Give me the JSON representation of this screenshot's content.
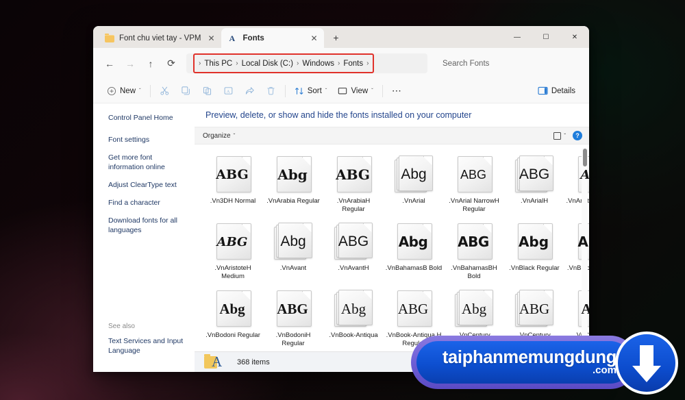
{
  "window": {
    "tabs": [
      {
        "label": "Font chu viet tay - VPM",
        "icon": "folder-icon",
        "active": false
      },
      {
        "label": "Fonts",
        "icon": "font-folder-icon",
        "active": true
      }
    ],
    "new_tab_label": "+",
    "controls": {
      "minimize": "—",
      "maximize": "☐",
      "close": "✕"
    }
  },
  "navigation": {
    "back_label": "←",
    "forward_label": "→",
    "up_label": "↑",
    "refresh_label": "⟳",
    "this_pc_icon": "monitor-icon",
    "breadcrumbs": [
      "This PC",
      "Local Disk (C:)",
      "Windows",
      "Fonts"
    ],
    "separator": "›",
    "leading_separator": "›",
    "trailing_separator": "›",
    "highlight_color": "#e0312a",
    "search_placeholder": "Search Fonts"
  },
  "toolbar": {
    "new_label": "New",
    "chevron": "ˇ",
    "cut_label": "cut-icon",
    "copy_label": "copy-icon",
    "paste_label": "paste-icon",
    "rename_label": "rename-icon",
    "share_label": "share-icon",
    "delete_label": "delete-icon",
    "sort_label": "Sort",
    "view_label": "View",
    "more_label": "⋯",
    "details_label": "Details"
  },
  "sidebar": {
    "home_label": "Control Panel Home",
    "links": [
      "Font settings",
      "Get more font information online",
      "Adjust ClearType text",
      "Find a character",
      "Download fonts for all languages"
    ],
    "see_also_label": "See also",
    "see_also_links": [
      "Text Services and Input Language"
    ]
  },
  "content": {
    "heading": "Preview, delete, or show and hide the fonts installed on your computer",
    "organize_label": "Organize",
    "organize_chevron": "ˇ",
    "view_chevron": "ˇ",
    "help_label": "?",
    "fonts": [
      {
        "glyph": "ABG",
        "label": ".Vn3DH Normal",
        "style": "dh",
        "stack": false
      },
      {
        "glyph": "Abg",
        "label": ".VnArabia Regular",
        "style": "arabia",
        "stack": false
      },
      {
        "glyph": "ABG",
        "label": ".VnArabiaH Regular",
        "style": "arabia",
        "stack": false
      },
      {
        "glyph": "Abg",
        "label": ".VnArial",
        "style": "sans",
        "stack": true
      },
      {
        "glyph": "ABG",
        "label": ".VnArial NarrowH Regular",
        "style": "narrow",
        "stack": false
      },
      {
        "glyph": "ABG",
        "label": ".VnArialH",
        "style": "sans",
        "stack": true
      },
      {
        "glyph": "Abg",
        "label": ".VnAristote Medium",
        "style": "script",
        "stack": false
      },
      {
        "glyph": "ABG",
        "label": ".VnAristoteH Medium",
        "style": "script",
        "stack": false
      },
      {
        "glyph": "Abg",
        "label": ".VnAvant",
        "style": "sans",
        "stack": true
      },
      {
        "glyph": "ABG",
        "label": ".VnAvantH",
        "style": "sans",
        "stack": true
      },
      {
        "glyph": "Abg",
        "label": ".VnBahamasB Bold",
        "style": "heavy",
        "stack": false
      },
      {
        "glyph": "ABG",
        "label": ".VnBahamasBH Bold",
        "style": "heavy",
        "stack": false
      },
      {
        "glyph": "Abg",
        "label": ".VnBlack Regular",
        "style": "black",
        "stack": false
      },
      {
        "glyph": "ABG",
        "label": ".VnBlackH Regular",
        "style": "black",
        "stack": false
      },
      {
        "glyph": "Abg",
        "label": ".VnBodoni Regular",
        "style": "serifbold",
        "stack": false
      },
      {
        "glyph": "ABG",
        "label": ".VnBodoniH Regular",
        "style": "serifbold",
        "stack": false
      },
      {
        "glyph": "Abg",
        "label": ".VnBook-Antiqua",
        "style": "serif",
        "stack": true
      },
      {
        "glyph": "ABG",
        "label": ".VnBook-Antiqua H Regular",
        "style": "serif",
        "stack": false
      },
      {
        "glyph": "Abg",
        "label": ".VnCentury Schoolbook",
        "style": "serif",
        "stack": true
      },
      {
        "glyph": "ABG",
        "label": ".VnCentury SchoolbookH",
        "style": "serif",
        "stack": true
      },
      {
        "glyph": "Abg",
        "label": ".VnClarendon Normal",
        "style": "serifbold",
        "stack": false
      }
    ]
  },
  "statusbar": {
    "item_count": "368 items",
    "folder_icon": "font-folder-icon"
  },
  "watermark": {
    "text": "taiphanmemungdung",
    "suffix": ".com",
    "icon": "download-arrow-icon"
  }
}
